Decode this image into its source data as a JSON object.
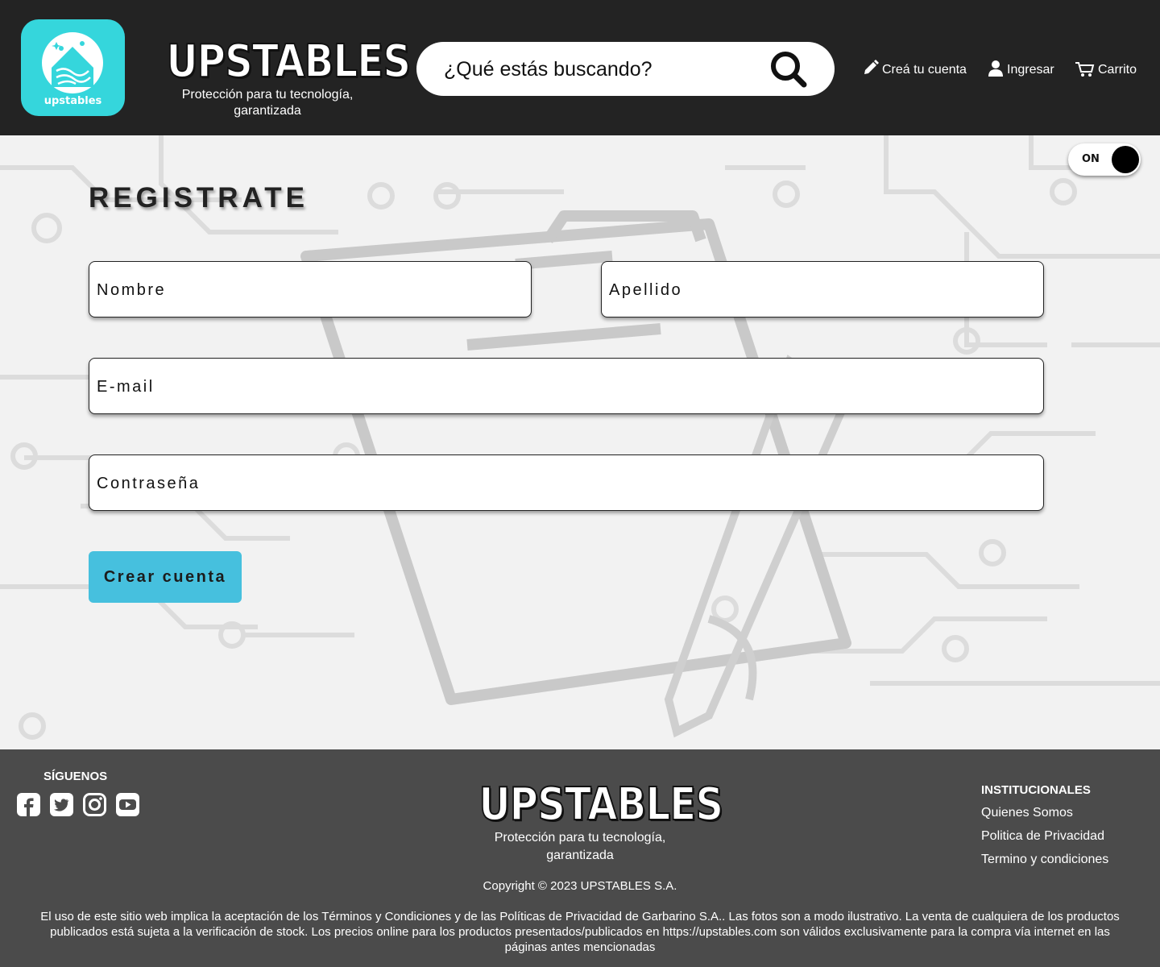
{
  "header": {
    "logo_text": "upstables",
    "brand_name": "UPSTABLES",
    "tagline_line1": "Protección para tu tecnología,",
    "tagline_line2": "garantizada",
    "search_placeholder": "¿Qué estás buscando?",
    "nav": {
      "create_account": "Creá tu cuenta",
      "login": "Ingresar",
      "cart": "Carrito"
    }
  },
  "toggle": {
    "label": "ON",
    "state": "on"
  },
  "form": {
    "title": "REGISTRATE",
    "first_name_placeholder": "Nombre",
    "last_name_placeholder": "Apellido",
    "email_placeholder": "E-mail",
    "password_placeholder": "Contraseña",
    "submit_label": "Crear cuenta"
  },
  "footer": {
    "follow_title": "SÍGUENOS",
    "social": [
      "facebook-icon",
      "twitter-icon",
      "instagram-icon",
      "youtube-icon"
    ],
    "brand_name": "UPSTABLES",
    "tagline_line1": "Protección para tu tecnología,",
    "tagline_line2": "garantizada",
    "copyright": "Copyright © 2023 UPSTABLES S.A.",
    "legal": "El uso de este sitio web implica la aceptación de los Términos y Condiciones y de las Políticas de Privacidad de Garbarino S.A.. Las fotos son a modo ilustrativo. La venta de cualquiera de los productos publicados está sujeta a la verificación de stock. Los precios online para los productos presentados/publicados en https://upstables.com  son válidos exclusivamente para la compra vía internet en las páginas antes mencionadas",
    "institutional": {
      "title": "INSTITUCIONALES",
      "links": [
        "Quienes Somos",
        "Politica de Privacidad",
        "Termino y condiciones"
      ]
    }
  },
  "colors": {
    "header_bg": "#232323",
    "logo_bg": "#35d6dc",
    "button_bg": "#46c0de",
    "footer_bg": "#4b4b4b",
    "main_bg": "#f2f2f2"
  }
}
